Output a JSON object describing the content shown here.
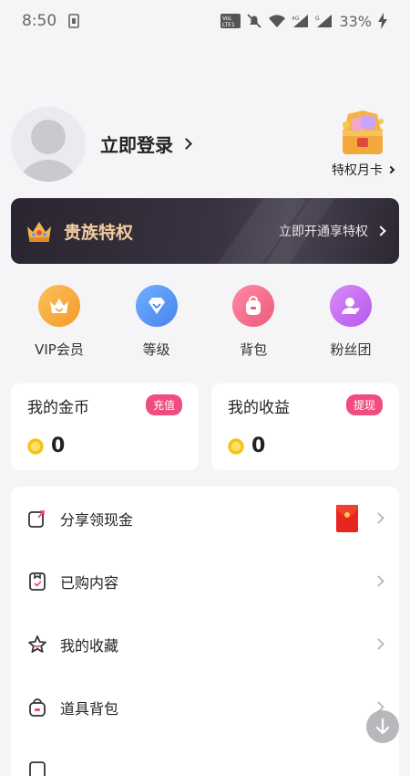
{
  "statusbar": {
    "time": "8:50",
    "battery": "33%"
  },
  "profile": {
    "login_label": "立即登录",
    "month_card_label": "特权月卡"
  },
  "banner": {
    "title": "贵族特权",
    "cta": "立即开通享特权"
  },
  "quick": [
    {
      "label": "VIP会员",
      "icon": "crown-icon",
      "color": "#f7a93a"
    },
    {
      "label": "等级",
      "icon": "diamond-icon",
      "color": "#5e9cf4"
    },
    {
      "label": "背包",
      "icon": "backpack-icon",
      "color": "#f06a86"
    },
    {
      "label": "粉丝团",
      "icon": "fan-group-icon",
      "color": "#c668f0"
    }
  ],
  "wallet": {
    "coins": {
      "title": "我的金币",
      "tag": "充值",
      "value": "0"
    },
    "earnings": {
      "title": "我的收益",
      "tag": "提现",
      "value": "0"
    }
  },
  "menu": [
    {
      "label": "分享领现金",
      "icon": "share-icon"
    },
    {
      "label": "已购内容",
      "icon": "purchased-icon"
    },
    {
      "label": "我的收藏",
      "icon": "star-icon"
    },
    {
      "label": "道具背包",
      "icon": "item-bag-icon"
    }
  ],
  "colors": {
    "accent": "#ef4c7f",
    "gold": "#f2cda1"
  }
}
